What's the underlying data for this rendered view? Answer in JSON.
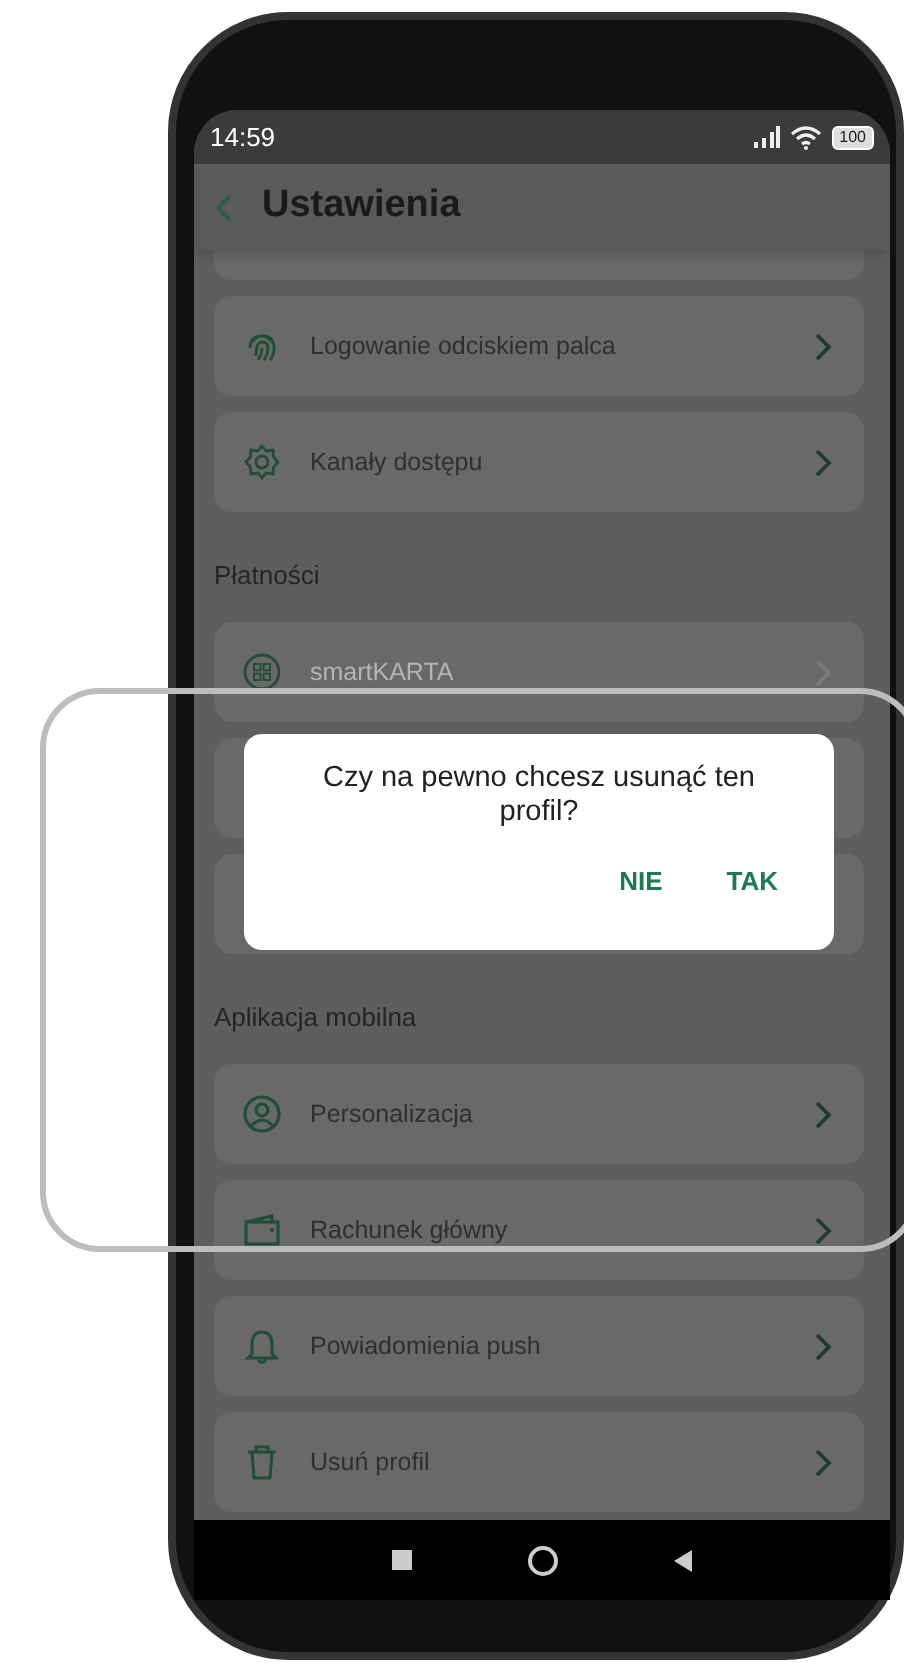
{
  "status_bar": {
    "time": "14:59",
    "battery": "100"
  },
  "header": {
    "title": "Ustawienia"
  },
  "groups": [
    {
      "items": [
        {
          "kind": "cut"
        },
        {
          "kind": "item",
          "label": "Logowanie odciskiem palca",
          "disabled": false
        },
        {
          "kind": "item",
          "label": "Kanały dostępu",
          "disabled": false
        }
      ]
    },
    {
      "title": "Płatności",
      "items": [
        {
          "kind": "item",
          "label": "smartKARTA",
          "disabled": true
        },
        {
          "kind": "covered"
        },
        {
          "kind": "covered"
        }
      ]
    },
    {
      "title": "Aplikacja mobilna",
      "items": [
        {
          "kind": "item",
          "label": "Personalizacja",
          "disabled": false
        },
        {
          "kind": "item",
          "label": "Rachunek główny",
          "disabled": false
        },
        {
          "kind": "item",
          "label": "Powiadomienia push",
          "disabled": false
        },
        {
          "kind": "item",
          "label": "Usuń profil",
          "disabled": false
        }
      ]
    }
  ],
  "dialog": {
    "message": "Czy na pewno chcesz usunąć ten profil?",
    "buttons": [
      "NIE",
      "TAK"
    ]
  }
}
